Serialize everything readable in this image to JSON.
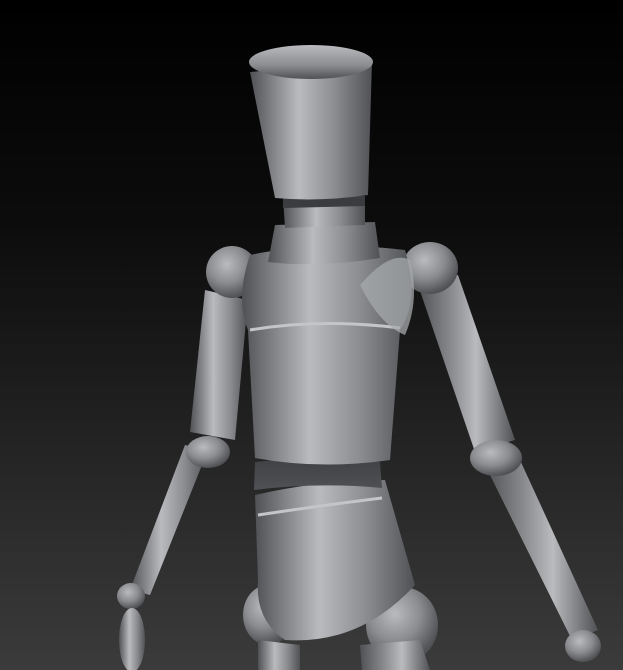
{
  "scene": {
    "subject": "mannequin-figure",
    "background_gradient": [
      "#000000",
      "#0d0d0d",
      "#262626",
      "#3b3b3b"
    ],
    "figure_colors": {
      "base": "#8a8c8f",
      "light": "#b9bbbe",
      "dark": "#4f5154",
      "waist_band": "#3f4144"
    }
  }
}
